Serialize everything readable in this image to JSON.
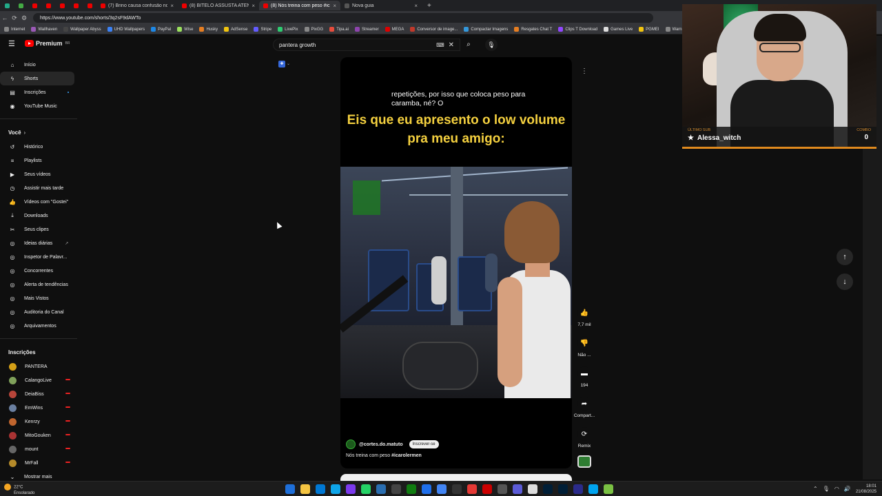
{
  "browser": {
    "tabs": [
      {
        "label": "",
        "kind": "mini"
      },
      {
        "label": "",
        "kind": "mini"
      },
      {
        "label": "",
        "kind": "mini"
      },
      {
        "label": "",
        "kind": "mini"
      },
      {
        "label": "",
        "kind": "mini"
      },
      {
        "label": "",
        "kind": "mini"
      },
      {
        "label": "",
        "kind": "mini"
      },
      {
        "label": "(7) Brino causa confusão no Rodi",
        "kind": "normal"
      },
      {
        "label": "(8) BITELO ASSUSTA ATENDENTE",
        "kind": "normal"
      },
      {
        "label": "(8) Nós treina com peso #ic",
        "kind": "active"
      },
      {
        "label": "Nova guia",
        "kind": "normal"
      }
    ],
    "new_tab": "+",
    "url": "https://www.youtube.com/shorts/3q2sF9dAWTo",
    "bookmarks": [
      {
        "label": "Internet",
        "color": "#888"
      },
      {
        "label": "Wallhaven",
        "color": "#9b59b6"
      },
      {
        "label": "Wallpaper Abyss",
        "color": "#444"
      },
      {
        "label": "UHD Wallpapers",
        "color": "#3b82f6"
      },
      {
        "label": "PayPal",
        "color": "#1e88e5"
      },
      {
        "label": "Wise",
        "color": "#9be15d"
      },
      {
        "label": "Husky",
        "color": "#e67e22"
      },
      {
        "label": "AdSense",
        "color": "#f1c40f"
      },
      {
        "label": "Stripe",
        "color": "#635bff"
      },
      {
        "label": "LivePix",
        "color": "#2ecc71"
      },
      {
        "label": "PixGG",
        "color": "#888"
      },
      {
        "label": "Tipa.ai",
        "color": "#e74c3c"
      },
      {
        "label": "Streamer",
        "color": "#8e44ad"
      },
      {
        "label": "MEGA",
        "color": "#d00"
      },
      {
        "label": "Conversor de image...",
        "color": "#c0392b"
      },
      {
        "label": "Compactar Imagens",
        "color": "#3498db"
      },
      {
        "label": "Resgates Chat T",
        "color": "#e67e22"
      },
      {
        "label": "Clips T Download",
        "color": "#9146ff"
      },
      {
        "label": "Games Live",
        "color": "#ddd"
      },
      {
        "label": "PGMEI",
        "color": "#f1c40f"
      },
      {
        "label": "Warn",
        "color": "#888"
      }
    ]
  },
  "youtube": {
    "logo": "Premium",
    "region": "BR",
    "search_value": "pantera growth",
    "sidebar": {
      "main": [
        {
          "label": "Início",
          "icon": "home-icon",
          "glyph": "⌂"
        },
        {
          "label": "Shorts",
          "icon": "shorts-icon",
          "glyph": "ϟ",
          "selected": true
        },
        {
          "label": "Inscrições",
          "icon": "subscriptions-icon",
          "glyph": "▤",
          "dot": true
        },
        {
          "label": "YouTube Music",
          "icon": "music-icon",
          "glyph": "◉"
        }
      ],
      "you_header": "Você",
      "you": [
        {
          "label": "Histórico",
          "icon": "history-icon",
          "glyph": "↺"
        },
        {
          "label": "Playlists",
          "icon": "playlists-icon",
          "glyph": "≡"
        },
        {
          "label": "Seus vídeos",
          "icon": "your-videos-icon",
          "glyph": "▶"
        },
        {
          "label": "Assistir mais tarde",
          "icon": "watch-later-icon",
          "glyph": "◷"
        },
        {
          "label": "Vídeos com \"Gostei\"",
          "icon": "liked-icon",
          "glyph": "👍"
        },
        {
          "label": "Downloads",
          "icon": "downloads-icon",
          "glyph": "⤓"
        },
        {
          "label": "Seus clipes",
          "icon": "clips-icon",
          "glyph": "✂"
        },
        {
          "label": "Ideias diárias",
          "icon": "ideas-icon",
          "glyph": "◎",
          "external": true
        },
        {
          "label": "Inspetor de Palavr...",
          "icon": "inspector-icon",
          "glyph": "◎"
        },
        {
          "label": "Concorrentes",
          "icon": "competitors-icon",
          "glyph": "◎"
        },
        {
          "label": "Alerta de tendências",
          "icon": "trends-icon",
          "glyph": "◎"
        },
        {
          "label": "Mais Vistos",
          "icon": "most-viewed-icon",
          "glyph": "◎"
        },
        {
          "label": "Auditoria do Canal",
          "icon": "audit-icon",
          "glyph": "◎"
        },
        {
          "label": "Arquivamentos",
          "icon": "archive-icon",
          "glyph": "◎"
        }
      ],
      "subs_header": "Inscrições",
      "subs": [
        {
          "label": "PANTERA",
          "color": "#d4a017",
          "live": false
        },
        {
          "label": "CalangoLive",
          "color": "#7fa05a",
          "live": true
        },
        {
          "label": "DeiaBiss",
          "color": "#b8453a",
          "live": true
        },
        {
          "label": "EmWins",
          "color": "#6a7fa0",
          "live": true
        },
        {
          "label": "Kenrzy",
          "color": "#c0652e",
          "live": true
        },
        {
          "label": "MitoGouken",
          "color": "#a33",
          "live": true
        },
        {
          "label": "mount",
          "color": "#666",
          "live": true
        },
        {
          "label": "MrFall",
          "color": "#b58b2a",
          "live": true
        }
      ],
      "show_more": "Mostrar mais"
    },
    "short": {
      "caption_small": "repetições, por isso que coloca peso para caramba, né? O",
      "caption_big": "Eis que eu apresento o low volume pra meu amigo:",
      "channel": "@cortes.do.matuto",
      "subscribe": "Inscrever-se",
      "title_prefix": "Nós treina com peso",
      "title_tag": "#icarolermen"
    },
    "actions": [
      {
        "glyph": "👍",
        "label": "7,7 mil",
        "icon": "like-icon"
      },
      {
        "glyph": "👎",
        "label": "Não ...",
        "icon": "dislike-icon"
      },
      {
        "glyph": "▬",
        "label": "194",
        "icon": "comments-icon"
      },
      {
        "glyph": "➦",
        "label": "Compart...",
        "icon": "share-icon"
      },
      {
        "glyph": "⟳",
        "label": "Remix",
        "icon": "remix-icon"
      }
    ]
  },
  "webcam": {
    "last_sub_label": "ÚLTIMO SUB",
    "last_sub_name": "Alessa_witch",
    "counter_label": "COMBO",
    "counter_value": "0"
  },
  "taskbar": {
    "temp": "22°C",
    "weather": "Ensolarado",
    "time": "18:01",
    "date": "21/08/2025",
    "apps": [
      "#1e6fd9",
      "#f5c542",
      "#0078d4",
      "#0ea5e9",
      "#7c3aed",
      "#25d366",
      "#2a6eb0",
      "#444",
      "#107c10",
      "#1f6feb",
      "#4285f4",
      "#333",
      "#e53935",
      "#c00",
      "#555",
      "#5b5bd6",
      "#ddd",
      "#001e36",
      "#001e36",
      "#2b2b8a",
      "#00a4ef",
      "#7ac143"
    ]
  }
}
